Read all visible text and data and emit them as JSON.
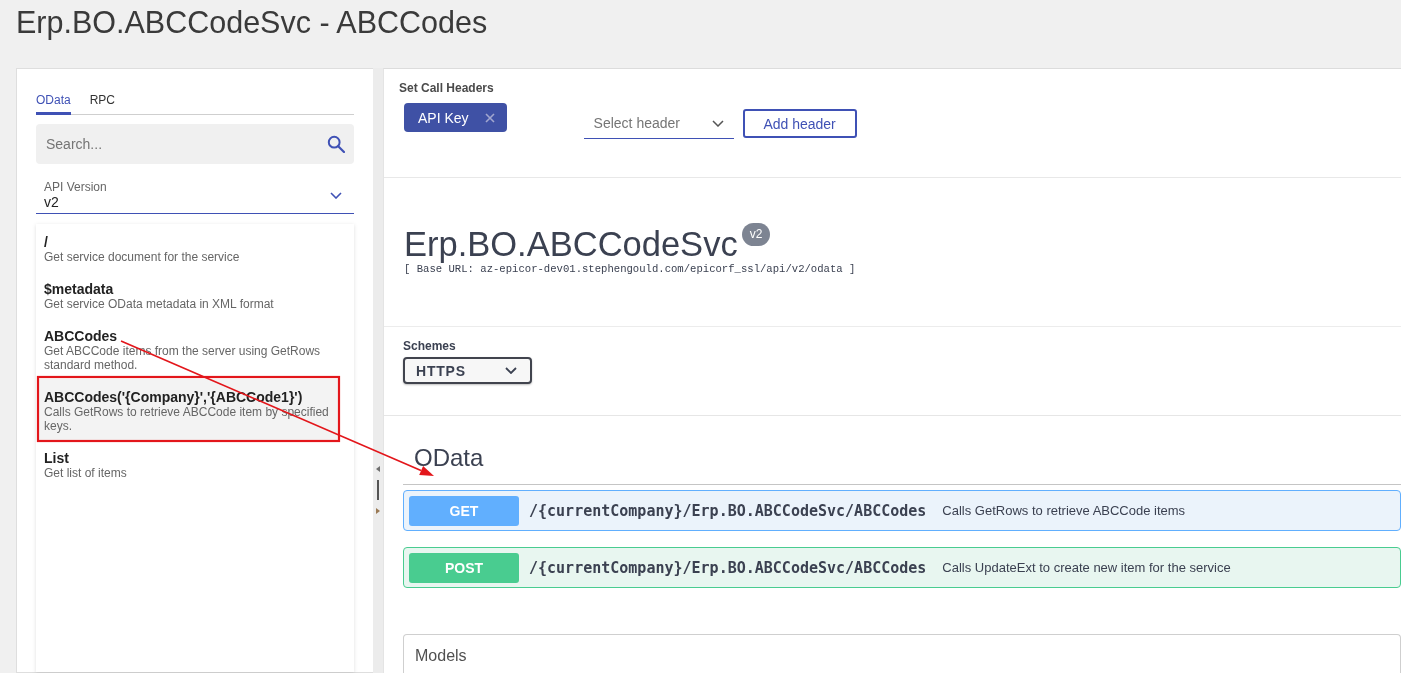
{
  "page_title": "Erp.BO.ABCCodeSvc - ABCCodes",
  "sidebar": {
    "tabs": [
      {
        "label": "OData",
        "selected": true
      },
      {
        "label": "RPC",
        "selected": false
      }
    ],
    "search": {
      "placeholder": "Search..."
    },
    "api_version": {
      "label": "API Version",
      "value": "v2"
    },
    "endpoints": [
      {
        "path": "/",
        "description": "Get service document for the service",
        "selected": false
      },
      {
        "path": "$metadata",
        "description": "Get service OData metadata in XML format",
        "selected": false
      },
      {
        "path": "ABCCodes",
        "description": "Get ABCCode items from the server using GetRows standard method.",
        "selected": false
      },
      {
        "path": "ABCCodes('{Company}','{ABCCode1}')",
        "description": "Calls GetRows to retrieve ABCCode item by specified keys.",
        "selected": true
      },
      {
        "path": "List",
        "description": "Get list of items",
        "selected": false
      }
    ]
  },
  "call_headers": {
    "title": "Set Call Headers",
    "chips": [
      {
        "label": "API Key"
      }
    ],
    "select": {
      "placeholder": "Select header"
    },
    "add_button": "Add header"
  },
  "service": {
    "title": "Erp.BO.ABCCodeSvc",
    "version": "v2",
    "base_url": "[ Base URL: az-epicor-dev01.stephengould.com/epicorf_ssl/api/v2/odata ]"
  },
  "schemes": {
    "label": "Schemes",
    "value": "HTTPS"
  },
  "odata": {
    "title": "OData",
    "operations": [
      {
        "kind": "get",
        "method": "GET",
        "path": "/{currentCompany}/Erp.BO.ABCCodeSvc/ABCCodes",
        "description": "Calls GetRows to retrieve ABCCode items"
      },
      {
        "kind": "post",
        "method": "POST",
        "path": "/{currentCompany}/Erp.BO.ABCCodeSvc/ABCCodes",
        "description": "Calls UpdateExt to create new item for the service"
      }
    ]
  },
  "models": {
    "title": "Models"
  }
}
